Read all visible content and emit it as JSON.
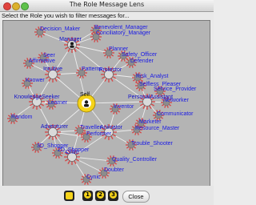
{
  "window": {
    "title": "The Role Message Lens"
  },
  "prompt": "Select the Role you wish to filter messages for...",
  "roles": [
    {
      "id": "self",
      "label": "Self",
      "kind": "center"
    },
    {
      "id": "manager",
      "label": "Manager",
      "kind": "hub"
    },
    {
      "id": "intuitive",
      "label": "Intuitive",
      "kind": "hub"
    },
    {
      "id": "protector",
      "label": "Protector",
      "kind": "hub"
    },
    {
      "id": "knowledgeseeker",
      "label": "KnowledgeSeeker",
      "kind": "hub"
    },
    {
      "id": "personalassistant",
      "label": "PersonalAssistant",
      "kind": "hub"
    },
    {
      "id": "adventurer",
      "label": "Adventurer",
      "kind": "hub"
    },
    {
      "id": "animator",
      "label": "Animator",
      "kind": "hub"
    },
    {
      "id": "critic",
      "label": "Critic",
      "kind": "hub"
    },
    {
      "id": "benevolent_manager",
      "label": "Benevolent_Manager",
      "kind": "leaf"
    },
    {
      "id": "conciliatory_manager",
      "label": "Conciliatory_Manager",
      "kind": "leaf"
    },
    {
      "id": "decision_maker",
      "label": "Decision_Maker",
      "kind": "leaf"
    },
    {
      "id": "planner",
      "label": "Planner",
      "kind": "leaf"
    },
    {
      "id": "safety_officer",
      "label": "Safety_Officer",
      "kind": "leaf"
    },
    {
      "id": "defender",
      "label": "Defender",
      "kind": "leaf"
    },
    {
      "id": "seer",
      "label": "Seer",
      "kind": "leaf"
    },
    {
      "id": "affirmative",
      "label": "Affirmative",
      "kind": "leaf"
    },
    {
      "id": "risk_analyst",
      "label": "Risk_Analyst",
      "kind": "leaf"
    },
    {
      "id": "selfless_pleaser",
      "label": "Selfless_Pleaser",
      "kind": "leaf"
    },
    {
      "id": "service_provider",
      "label": "Service_Provider",
      "kind": "leaf"
    },
    {
      "id": "networker",
      "label": "Networker",
      "kind": "leaf"
    },
    {
      "id": "knower",
      "label": "Knower",
      "kind": "leaf"
    },
    {
      "id": "learner",
      "label": "Learner",
      "kind": "leaf"
    },
    {
      "id": "patterns",
      "label": "Patterns",
      "kind": "leaf"
    },
    {
      "id": "random",
      "label": "Random",
      "kind": "leaf"
    },
    {
      "id": "communicator",
      "label": "Communicator",
      "kind": "leaf"
    },
    {
      "id": "marketer",
      "label": "Marketer",
      "kind": "leaf"
    },
    {
      "id": "resource_master",
      "label": "Resource_Master",
      "kind": "leaf"
    },
    {
      "id": "inventor",
      "label": "Inventor",
      "kind": "leaf"
    },
    {
      "id": "traveller",
      "label": "Traveller",
      "kind": "leaf"
    },
    {
      "id": "performer",
      "label": "Performer",
      "kind": "leaf"
    },
    {
      "id": "3d_shopper",
      "label": "3D_Shopper",
      "kind": "leaf"
    },
    {
      "id": "2d_shopper",
      "label": "2D_Shopper",
      "kind": "leaf"
    },
    {
      "id": "trouble_shooter",
      "label": "Trouble_Shooter",
      "kind": "leaf"
    },
    {
      "id": "quality_controller",
      "label": "Quality_Controller",
      "kind": "leaf"
    },
    {
      "id": "doubter",
      "label": "Doubter",
      "kind": "leaf"
    },
    {
      "id": "cynic",
      "label": "Cynic",
      "kind": "leaf"
    }
  ],
  "buttons": {
    "nav1": "1",
    "nav2": "2",
    "nav3": "3",
    "close": "Close"
  },
  "colors": {
    "label_text": "#1a1ae6",
    "center_yellow": "#f5d31a",
    "hub_red": "#d44a4a",
    "node_gray": "#8c8c8c",
    "canvas_bg": "#b4b4b4"
  },
  "icons": {
    "home": "home-icon",
    "close_window": "close-window-icon",
    "minimize_window": "minimize-window-icon",
    "maximize_window": "maximize-window-icon"
  }
}
